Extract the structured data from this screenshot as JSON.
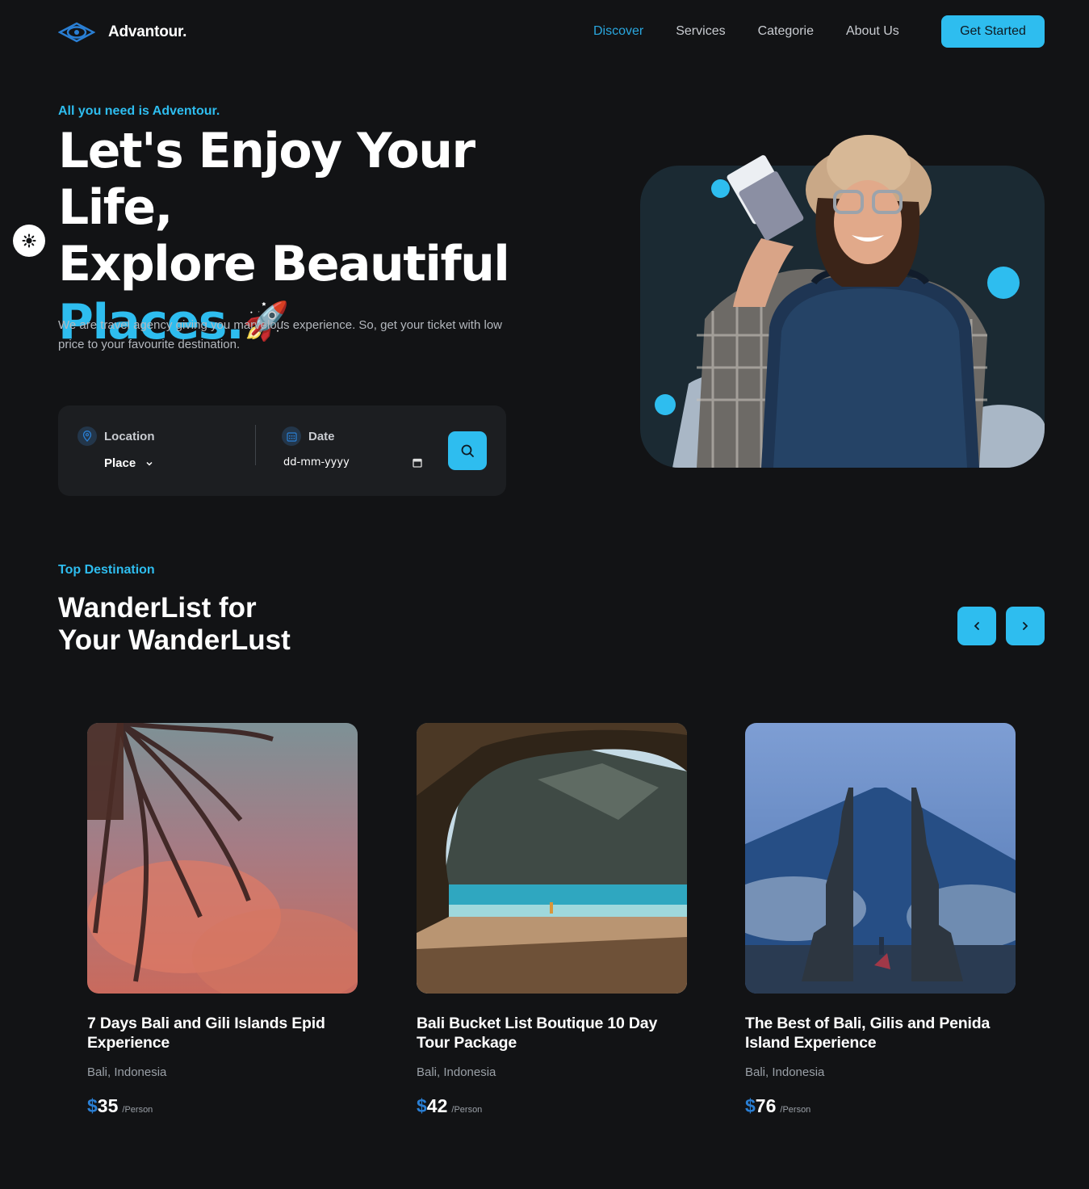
{
  "brand": {
    "name": "Advantour."
  },
  "nav": {
    "links": [
      "Discover",
      "Services",
      "Categorie",
      "About Us"
    ],
    "cta": "Get Started"
  },
  "hero": {
    "eyebrow": "All you need is Adventour.",
    "title_line1": "Let's Enjoy Your Life,",
    "title_line2": "Explore Beautiful",
    "title_accent": "Places.",
    "rocket": "🚀",
    "description": "We are travel agency giving you marvelous experience. So, get your ticket with low price to your favourite destination."
  },
  "search": {
    "location_label": "Location",
    "location_value": "Place",
    "date_label": "Date",
    "date_placeholder": "dd-mm-yyyy"
  },
  "destinations": {
    "eyebrow": "Top Destination",
    "title_line1": "WanderList for",
    "title_line2": "Your WanderLust",
    "cards": [
      {
        "title": "7 Days Bali and Gili Islands Epid Experience",
        "location": "Bali, Indonesia",
        "currency": "$",
        "price": "35",
        "unit": "/Person"
      },
      {
        "title": "Bali Bucket List Boutique 10 Day Tour Package",
        "location": "Bali, Indonesia",
        "currency": "$",
        "price": "42",
        "unit": "/Person"
      },
      {
        "title": "The Best of Bali, Gilis and Penida Island Experience",
        "location": "Bali, Indonesia",
        "currency": "$",
        "price": "76",
        "unit": "/Person"
      }
    ]
  },
  "colors": {
    "accent": "#2ebdef",
    "background": "#121315",
    "card": "#1c1e21",
    "price": "#2a7fd4"
  }
}
